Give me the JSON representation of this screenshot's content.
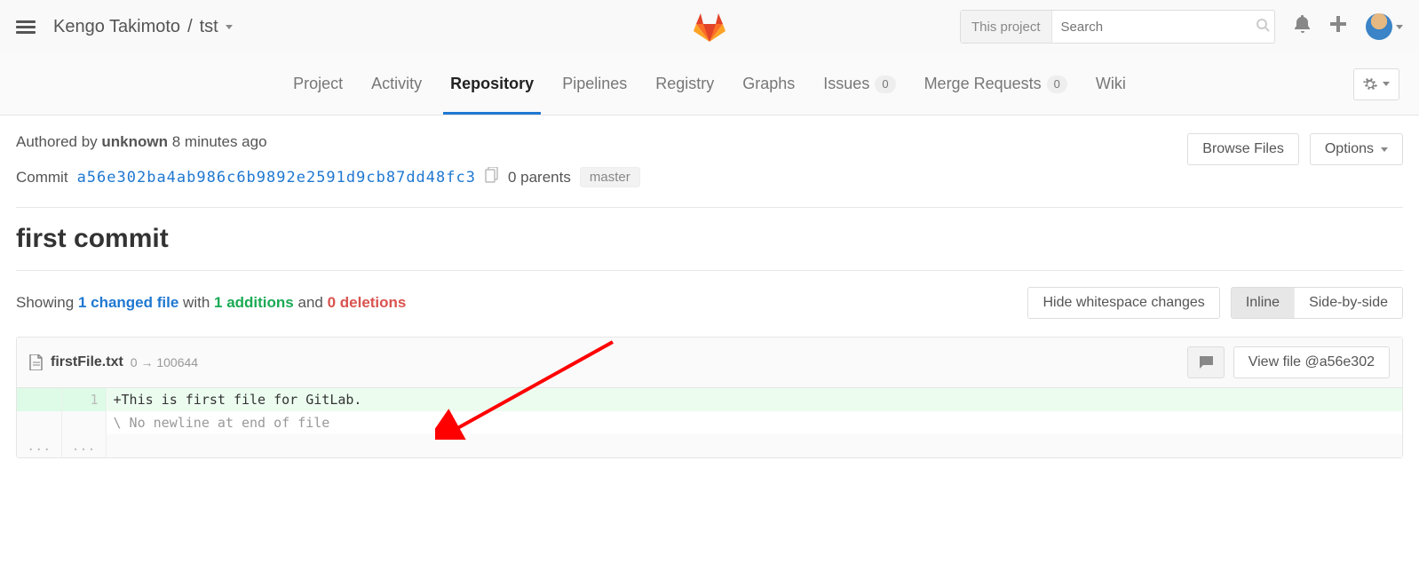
{
  "header": {
    "breadcrumb_owner": "Kengo Takimoto",
    "breadcrumb_sep": "/",
    "breadcrumb_project": "tst",
    "search_scope": "This project",
    "search_placeholder": "Search"
  },
  "tabs": {
    "project": "Project",
    "activity": "Activity",
    "repository": "Repository",
    "pipelines": "Pipelines",
    "registry": "Registry",
    "graphs": "Graphs",
    "issues": "Issues",
    "issues_count": "0",
    "merge_requests": "Merge Requests",
    "mr_count": "0",
    "wiki": "Wiki"
  },
  "commit": {
    "authored_prefix": "Authored by ",
    "author": "unknown",
    "authored_time": " 8 minutes ago",
    "browse_btn": "Browse Files",
    "options_btn": "Options",
    "commit_word": "Commit ",
    "sha": "a56e302ba4ab986c6b9892e2591d9cb87dd48fc3",
    "parents": "0 parents",
    "branch": "master",
    "title": "first commit"
  },
  "diffstat": {
    "prefix": "Showing ",
    "changed_files": "1 changed file",
    "with_word": " with ",
    "additions": "1 additions",
    "and_word": " and ",
    "deletions": "0 deletions",
    "hide_ws": "Hide whitespace changes",
    "inline": "Inline",
    "sbs": "Side-by-side"
  },
  "file": {
    "name": "firstFile.txt",
    "mode": " 0 → 100644",
    "view_file": "View file @a56e302",
    "line1_num": "1",
    "line1_content": "+This is first file for GitLab.",
    "nonewline": "\\ No newline at end of file",
    "ellipsis": "..."
  }
}
